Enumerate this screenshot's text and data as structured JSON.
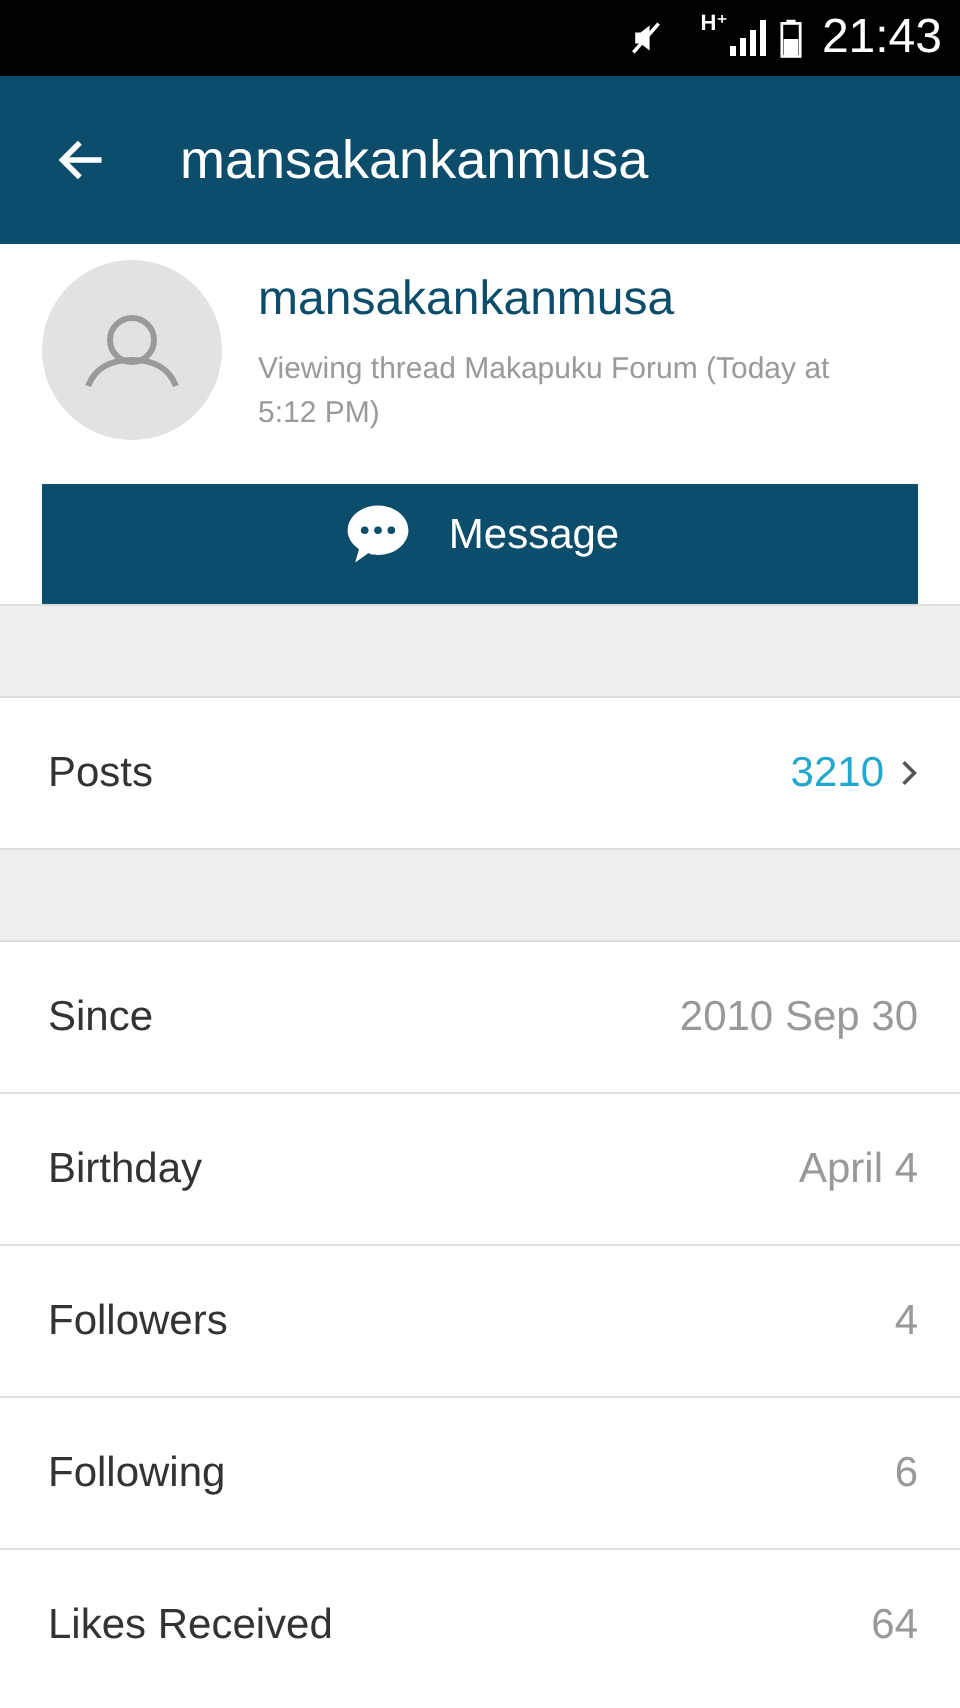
{
  "status_bar": {
    "network": "H⁺",
    "time": "21:43"
  },
  "app_bar": {
    "title": "mansakankanmusa"
  },
  "profile": {
    "name": "mansakankanmusa",
    "activity": "Viewing thread Makapuku Forum (Today at 5:12 PM)",
    "message_button": "Message"
  },
  "sections": [
    [
      {
        "kind": "link",
        "label": "Posts",
        "value": "3210"
      }
    ],
    [
      {
        "kind": "plain",
        "label": "Since",
        "value": "2010 Sep 30"
      },
      {
        "kind": "plain",
        "label": "Birthday",
        "value": "April 4"
      },
      {
        "kind": "plain",
        "label": "Followers",
        "value": "4"
      },
      {
        "kind": "plain",
        "label": "Following",
        "value": "6"
      },
      {
        "kind": "plain",
        "label": "Likes Received",
        "value": "64"
      }
    ]
  ]
}
